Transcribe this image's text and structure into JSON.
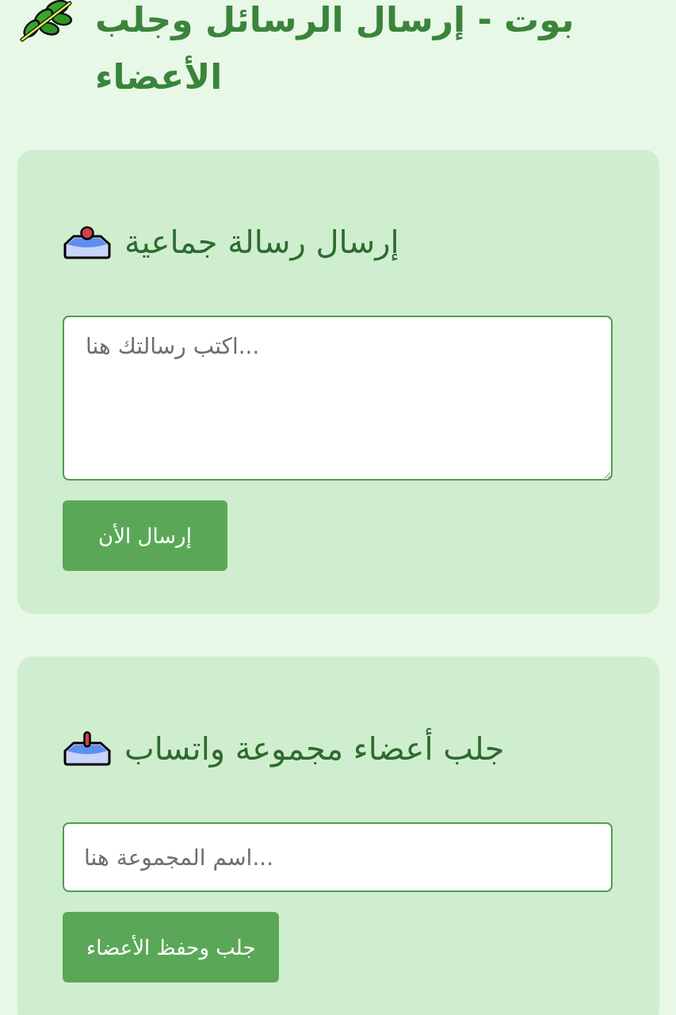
{
  "header": {
    "title": "بوت - إرسال الرسائل وجلب الأعضاء"
  },
  "cards": [
    {
      "kind": "send",
      "heading": "إرسال رسالة جماعية",
      "field": {
        "kind": "textarea",
        "placeholder": "اكتب رسالتك هنا..."
      },
      "button": "إرسال الأن"
    },
    {
      "kind": "fetch",
      "heading": "جلب أعضاء مجموعة واتساب",
      "field": {
        "kind": "input",
        "placeholder": "اسم المجموعة هنا..."
      },
      "button": "جلب وحفظ الأعضاء"
    }
  ]
}
